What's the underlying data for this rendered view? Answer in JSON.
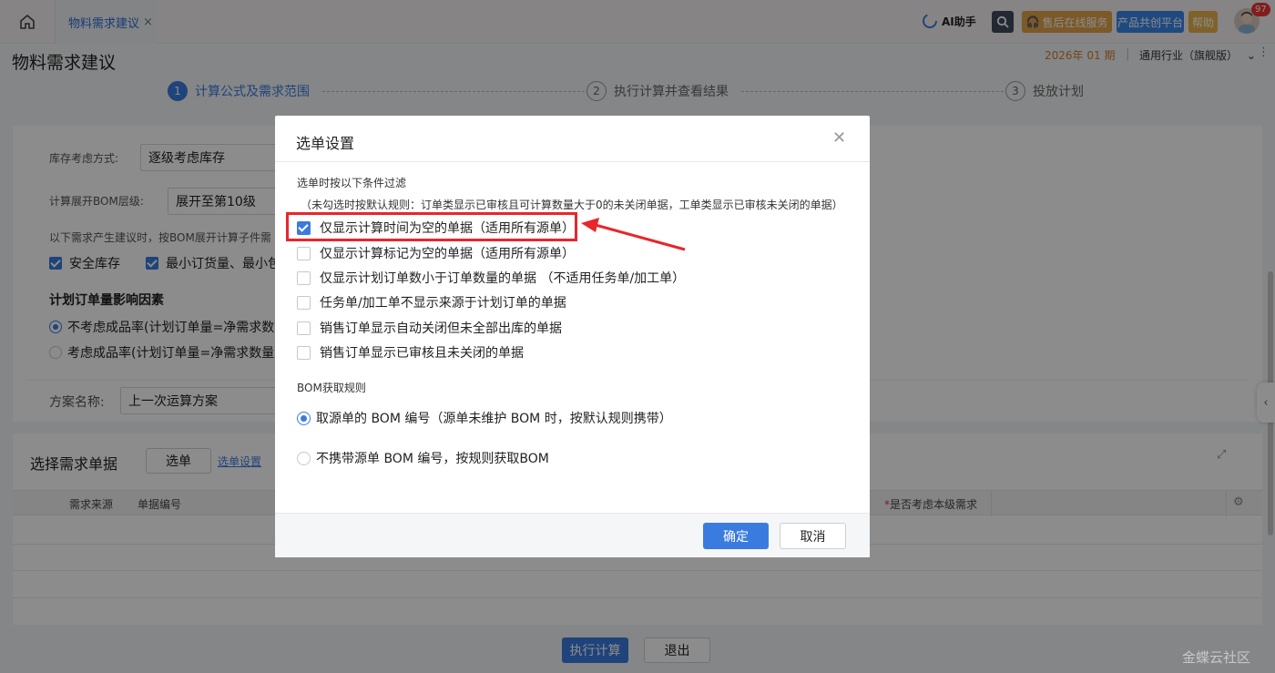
{
  "topbar": {
    "tab_label": "物料需求建议",
    "ai_label": "AI助手",
    "support_label": "售后在线服务",
    "platform_label": "产品共创平台",
    "help_label": "帮助",
    "badge_count": "97"
  },
  "header": {
    "title": "物料需求建议",
    "period": "2026年 01 期",
    "edition": "通用行业（旗舰版）"
  },
  "steps": [
    {
      "num": "1",
      "label": "计算公式及需求范围"
    },
    {
      "num": "2",
      "label": "执行计算并查看结果"
    },
    {
      "num": "3",
      "label": "投放计划"
    }
  ],
  "form": {
    "stock_label": "库存考虑方式:",
    "stock_value": "逐级考虑库存",
    "bom_label": "计算展开BOM层级:",
    "bom_value": "展开至第10级",
    "note": "以下需求产生建议时，按BOM展开计算子件需",
    "check_safety": "安全库存",
    "check_min": "最小订货量、最小包",
    "factor_title": "计划订单量影响因素",
    "radio_no_yield": "不考虑成品率(计划订单量=净需求数",
    "radio_yield": "考虑成品率(计划订单量=净需求数量",
    "plan_label": "方案名称:",
    "plan_value": "上一次运算方案"
  },
  "docs": {
    "title": "选择需求单据",
    "select_btn": "选单",
    "settings_link": "选单设置",
    "col_source": "需求来源",
    "col_no": "单据编号",
    "col_consider": "是否考虑本级需求"
  },
  "footer": {
    "run_btn": "执行计算",
    "exit_btn": "退出"
  },
  "watermark": "金蝶云社区",
  "modal": {
    "title": "选单设置",
    "filter_label": "选单时按以下条件过滤",
    "filter_note": "（未勾选时按默认规则：订单类显示已审核且可计算数量大于0的未关闭单据，工单类显示已审核未关闭的单据）",
    "options": [
      {
        "label": "仅显示计算时间为空的单据（适用所有源单）",
        "checked": true
      },
      {
        "label": "仅显示计算标记为空的单据（适用所有源单）",
        "checked": false
      },
      {
        "label": "仅显示计划订单数小于订单数量的单据 （不适用任务单/加工单）",
        "checked": false
      },
      {
        "label": "任务单/加工单不显示来源于计划订单的单据",
        "checked": false
      },
      {
        "label": "销售订单显示自动关闭但未全部出库的单据",
        "checked": false
      },
      {
        "label": "销售订单显示已审核且未关闭的单据",
        "checked": false
      }
    ],
    "bom_label": "BOM获取规则",
    "bom_options": [
      {
        "label": "取源单的 BOM 编号（源单未维护 BOM 时，按默认规则携带）",
        "selected": true
      },
      {
        "label": "不携带源单 BOM 编号，按规则获取BOM",
        "selected": false
      }
    ],
    "ok_btn": "确定",
    "cancel_btn": "取消"
  }
}
